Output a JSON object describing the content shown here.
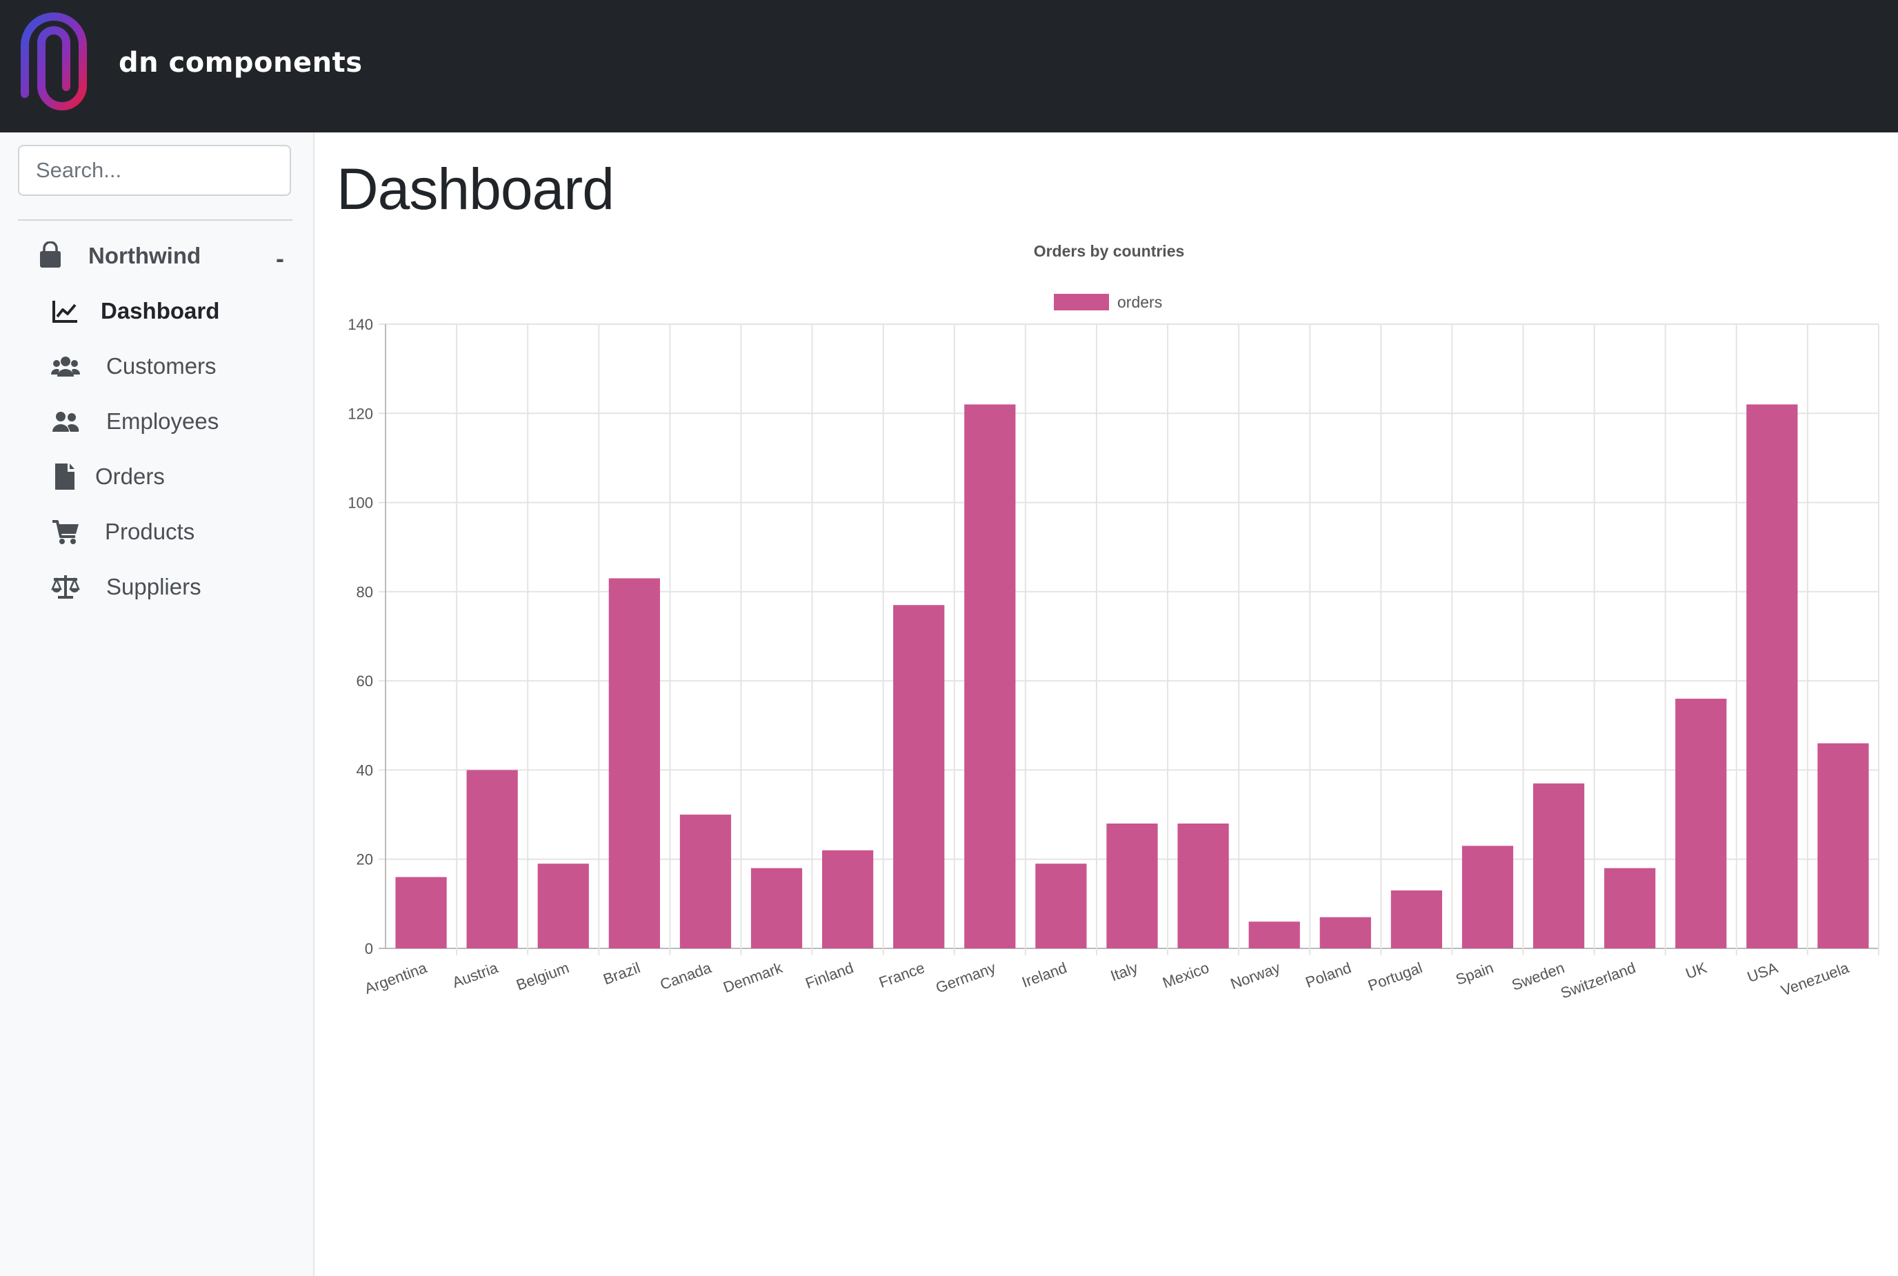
{
  "brand": {
    "name": "dn components"
  },
  "search": {
    "placeholder": "Search..."
  },
  "sidebar": {
    "group": {
      "label": "Northwind",
      "toggle": "-",
      "icon": "shopping-bag-icon"
    },
    "items": [
      {
        "label": "Dashboard",
        "icon": "chart-line-icon",
        "active": true
      },
      {
        "label": "Customers",
        "icon": "users-icon",
        "active": false
      },
      {
        "label": "Employees",
        "icon": "user-friends-icon",
        "active": false
      },
      {
        "label": "Orders",
        "icon": "file-icon",
        "active": false
      },
      {
        "label": "Products",
        "icon": "shopping-cart-icon",
        "active": false
      },
      {
        "label": "Suppliers",
        "icon": "balance-scale-icon",
        "active": false
      }
    ]
  },
  "main": {
    "title": "Dashboard"
  },
  "colors": {
    "topbar": "#212529",
    "bar": "#c9558f",
    "sidebar_bg": "#f8f9fa",
    "logo_gradient_start": "#3b4fd8",
    "logo_gradient_end": "#e11d48"
  },
  "chart_data": {
    "type": "bar",
    "title": "Orders by countries",
    "categories": [
      "Argentina",
      "Austria",
      "Belgium",
      "Brazil",
      "Canada",
      "Denmark",
      "Finland",
      "France",
      "Germany",
      "Ireland",
      "Italy",
      "Mexico",
      "Norway",
      "Poland",
      "Portugal",
      "Spain",
      "Sweden",
      "Switzerland",
      "UK",
      "USA",
      "Venezuela"
    ],
    "series": [
      {
        "name": "orders",
        "values": [
          16,
          40,
          19,
          83,
          30,
          18,
          22,
          77,
          122,
          19,
          28,
          28,
          6,
          7,
          13,
          23,
          37,
          18,
          56,
          122,
          46
        ]
      }
    ],
    "ylim": [
      0,
      140
    ],
    "yticks": [
      0,
      20,
      40,
      60,
      80,
      100,
      120,
      140
    ],
    "grid": true,
    "legend": "top-center"
  }
}
